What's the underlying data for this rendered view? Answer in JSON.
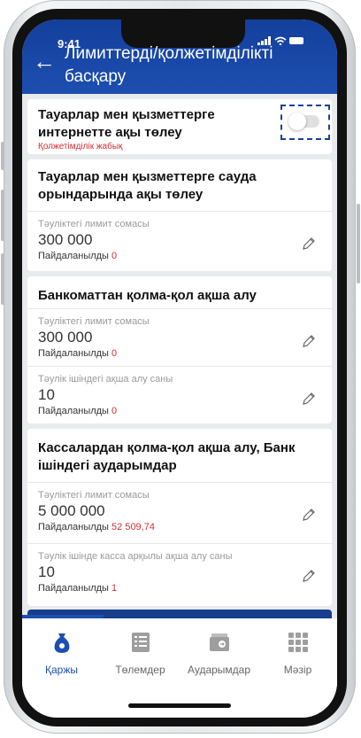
{
  "status": {
    "time": "9:41"
  },
  "header": {
    "title": "Лимиттерді/қолжетімділікті басқару"
  },
  "cards": [
    {
      "title": "Тауарлар мен қызметтерге интернетте ақы төлеу",
      "status": "Қолжетімділік жабық",
      "toggle_on": false
    },
    {
      "title": "Тауарлар мен қызметтерге сауда орындарында ақы төлеу",
      "rows": [
        {
          "label": "Тәуліктегі лимит сомасы",
          "value": "300 000",
          "used_label": "Пайдаланылды",
          "used_value": "0"
        }
      ]
    },
    {
      "title": "Банкоматтан қолма-қол ақша алу",
      "rows": [
        {
          "label": "Тәуліктегі лимит сомасы",
          "value": "300 000",
          "used_label": "Пайдаланылды",
          "used_value": "0"
        },
        {
          "label": "Тәулік ішіндегі ақша алу саны",
          "value": "10",
          "used_label": "Пайдаланылды",
          "used_value": "0"
        }
      ]
    },
    {
      "title": "Кассалардан қолма-қол ақша алу, Банк ішіндегі аударымдар",
      "rows": [
        {
          "label": "Тәуліктегі лимит сомасы",
          "value": "5 000 000",
          "used_label": "Пайдаланылды",
          "used_value": "52 509,74"
        },
        {
          "label": "Тәулік ішінде касса арқылы ақша алу саны",
          "value": "10",
          "used_label": "Пайдаланылды",
          "used_value": "1"
        }
      ]
    }
  ],
  "tabs": [
    {
      "label": "Қаржы",
      "icon": "money-bag-icon",
      "active": true
    },
    {
      "label": "Төлемдер",
      "icon": "list-icon",
      "active": false
    },
    {
      "label": "Аударымдар",
      "icon": "wallet-transfer-icon",
      "active": false
    },
    {
      "label": "Мәзір",
      "icon": "grid-menu-icon",
      "active": false
    }
  ],
  "colors": {
    "primary": "#1d4fb0",
    "red": "#d32f2f"
  }
}
